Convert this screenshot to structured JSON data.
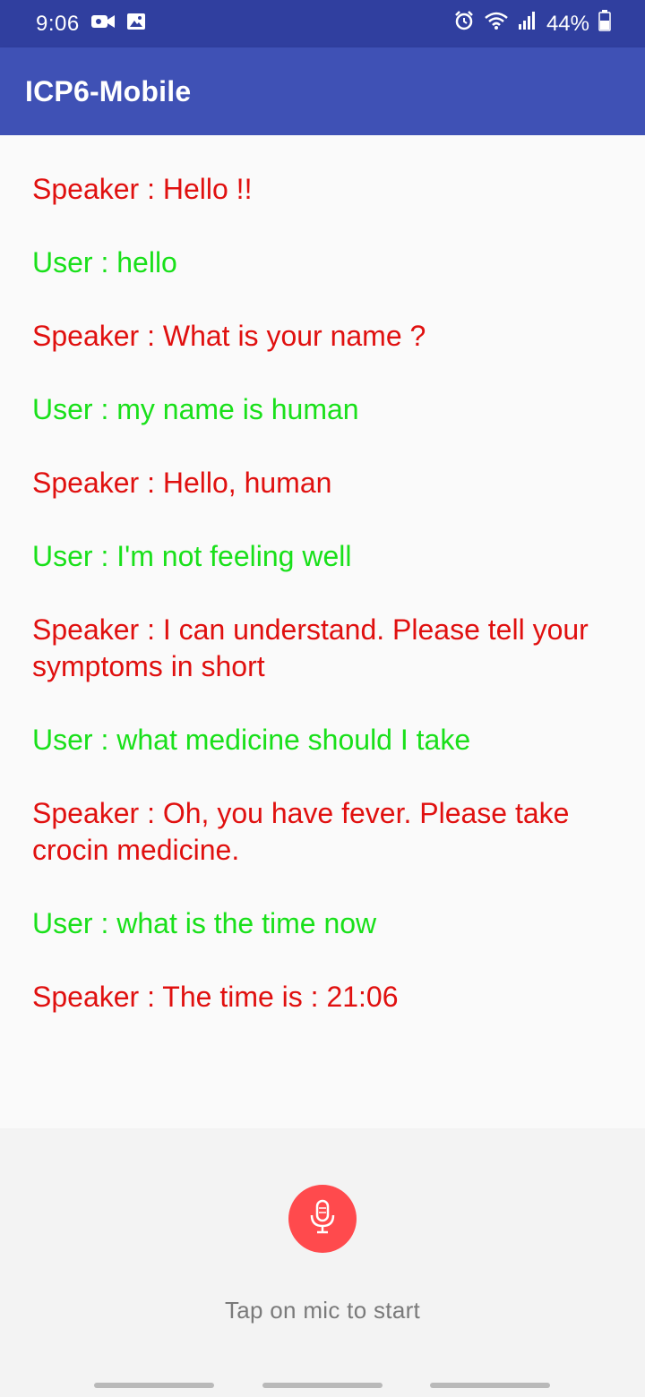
{
  "status_bar": {
    "time": "9:06",
    "battery_percent": "44%",
    "icons": [
      "video-camera-icon",
      "image-icon",
      "alarm-icon",
      "wifi-icon",
      "signal-icon",
      "battery-icon"
    ],
    "background": "#303f9f"
  },
  "app_bar": {
    "title": "ICP6-Mobile",
    "background": "#3f51b5"
  },
  "conversation": {
    "speaker_color": "#e0100f",
    "user_color": "#19e01a",
    "messages": [
      {
        "role": "speaker",
        "text": "Speaker : Hello !!"
      },
      {
        "role": "user",
        "text": "User : hello"
      },
      {
        "role": "speaker",
        "text": "Speaker : What is your name ?"
      },
      {
        "role": "user",
        "text": "User : my name is human"
      },
      {
        "role": "speaker",
        "text": "Speaker : Hello, human"
      },
      {
        "role": "user",
        "text": "User : I'm not feeling well"
      },
      {
        "role": "speaker",
        "text": "Speaker : I can understand. Please tell your symptoms in short"
      },
      {
        "role": "user",
        "text": "User : what medicine should I take"
      },
      {
        "role": "speaker",
        "text": "Speaker : Oh, you have fever. Please take crocin medicine."
      },
      {
        "role": "user",
        "text": "User : what is the time now"
      },
      {
        "role": "speaker",
        "text": "Speaker : The time is : 21:06"
      }
    ]
  },
  "voice_input": {
    "mic_icon": "microphone-icon",
    "mic_color": "#ff4a4d",
    "hint": "Tap on mic to start"
  }
}
